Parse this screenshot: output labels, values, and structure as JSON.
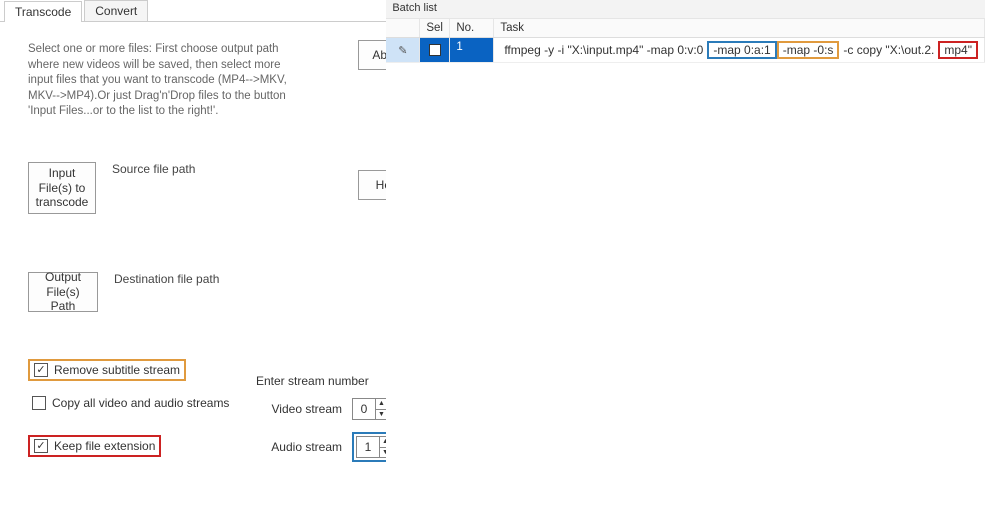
{
  "tabs": {
    "transcode": "Transcode",
    "convert": "Convert"
  },
  "instructions": "Select one or more files: First choose output path where new videos will be saved, then select more input files that you want to transcode (MP4-->MKV, MKV-->MP4).Or just Drag'n'Drop files to the button 'Input Files...or to the list to the right!'.",
  "buttons": {
    "about": "About",
    "help": "Help",
    "input_files": "Input File(s) to transcode",
    "output_path": "Output File(s) Path"
  },
  "labels": {
    "source_path": "Source file path",
    "dest_path": "Destination file path"
  },
  "checks": {
    "remove_sub": {
      "label": "Remove subtitle stream",
      "checked": true
    },
    "copy_all": {
      "label": "Copy all video and audio streams",
      "checked": false
    },
    "keep_ext": {
      "label": "Keep file extension",
      "checked": true
    }
  },
  "streams": {
    "title": "Enter stream number",
    "video_label": "Video stream",
    "audio_label": "Audio stream",
    "video_value": "0",
    "audio_value": "1"
  },
  "batch": {
    "title": "Batch list",
    "headers": {
      "sel": "Sel",
      "no": "No.",
      "task": "Task"
    },
    "row": {
      "no": "1",
      "parts": {
        "a": "ffmpeg -y -i \"X:\\input.mp4\"  -map 0:v:0",
        "b": "-map 0:a:1",
        "c": "-map -0:s",
        "d": "-c copy \"X:\\out.2.",
        "e": "mp4\""
      }
    }
  }
}
